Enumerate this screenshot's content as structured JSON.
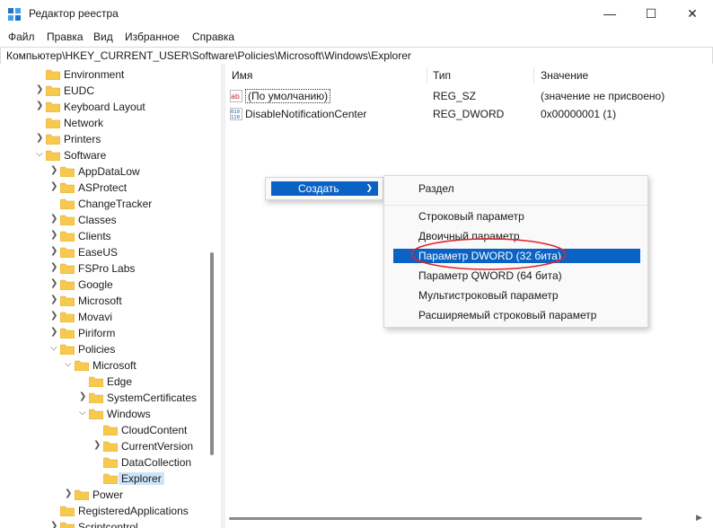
{
  "window": {
    "title": "Редактор реестра",
    "minimize_glyph": "—",
    "maximize_glyph": "☐",
    "close_glyph": "✕"
  },
  "menubar": {
    "items": [
      "Файл",
      "Правка",
      "Вид",
      "Избранное",
      "Справка"
    ]
  },
  "address": {
    "path": "Компьютер\\HKEY_CURRENT_USER\\Software\\Policies\\Microsoft\\Windows\\Explorer"
  },
  "tree": {
    "items": [
      {
        "label": "Environment",
        "expander": "none",
        "selected": false
      },
      {
        "label": "EUDC",
        "expander": "collapsed",
        "selected": false
      },
      {
        "label": "Keyboard Layout",
        "expander": "collapsed",
        "selected": false
      },
      {
        "label": "Network",
        "expander": "none",
        "selected": false
      },
      {
        "label": "Printers",
        "expander": "collapsed",
        "selected": false
      },
      {
        "label": "Software",
        "expander": "expanded",
        "selected": false
      },
      {
        "label": "AppDataLow",
        "expander": "collapsed",
        "selected": false
      },
      {
        "label": "ASProtect",
        "expander": "collapsed",
        "selected": false
      },
      {
        "label": "ChangeTracker",
        "expander": "none",
        "selected": false
      },
      {
        "label": "Classes",
        "expander": "collapsed",
        "selected": false
      },
      {
        "label": "Clients",
        "expander": "collapsed",
        "selected": false
      },
      {
        "label": "EaseUS",
        "expander": "collapsed",
        "selected": false
      },
      {
        "label": "FSPro Labs",
        "expander": "collapsed",
        "selected": false
      },
      {
        "label": "Google",
        "expander": "collapsed",
        "selected": false
      },
      {
        "label": "Microsoft",
        "expander": "collapsed",
        "selected": false
      },
      {
        "label": "Movavi",
        "expander": "collapsed",
        "selected": false
      },
      {
        "label": "Piriform",
        "expander": "collapsed",
        "selected": false
      },
      {
        "label": "Policies",
        "expander": "expanded",
        "selected": false
      },
      {
        "label": "Microsoft",
        "expander": "expanded",
        "selected": false
      },
      {
        "label": "Edge",
        "expander": "none",
        "selected": false
      },
      {
        "label": "SystemCertificates",
        "expander": "collapsed",
        "selected": false
      },
      {
        "label": "Windows",
        "expander": "expanded",
        "selected": false
      },
      {
        "label": "CloudContent",
        "expander": "none",
        "selected": false
      },
      {
        "label": "CurrentVersion",
        "expander": "collapsed",
        "selected": false
      },
      {
        "label": "DataCollection",
        "expander": "none",
        "selected": false
      },
      {
        "label": "Explorer",
        "expander": "none",
        "selected": true
      },
      {
        "label": "Power",
        "expander": "collapsed",
        "selected": false
      },
      {
        "label": "RegisteredApplications",
        "expander": "none",
        "selected": false
      },
      {
        "label": "Scriptcontrol",
        "expander": "collapsed",
        "selected": false
      }
    ]
  },
  "list": {
    "columns": [
      "Имя",
      "Тип",
      "Значение"
    ],
    "rows": [
      {
        "icon": "string-value-icon",
        "name": "(По умолчанию)",
        "type": "REG_SZ",
        "value": "(значение не присвоено)"
      },
      {
        "icon": "binary-value-icon",
        "name": "DisableNotificationCenter",
        "type": "REG_DWORD",
        "value": "0x00000001 (1)"
      }
    ]
  },
  "context_menu": {
    "parent_item": "Создать",
    "submenu_items": [
      "Раздел",
      "Строковый параметр",
      "Двоичный параметр",
      "Параметр DWORD (32 бита)",
      "Параметр QWORD (64 бита)",
      "Мультистроковый параметр",
      "Расширяемый строковый параметр"
    ],
    "highlighted_index": 3
  },
  "colors": {
    "highlight": "#0a63c4",
    "annotation": "#e0242b",
    "folder": "#f7c94e",
    "selection": "#cce4f7"
  }
}
